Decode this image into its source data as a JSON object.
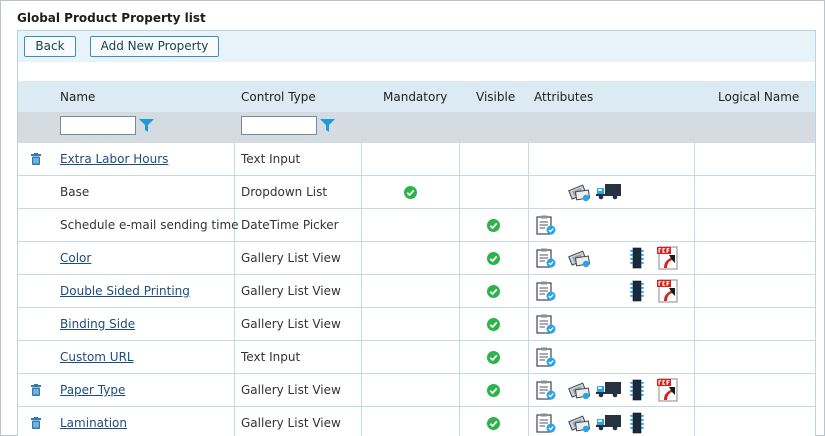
{
  "page_title": "Global Product Property list",
  "toolbar": {
    "back_label": "Back",
    "add_label": "Add New Property"
  },
  "columns": {
    "name": "Name",
    "control_type": "Control Type",
    "mandatory": "Mandatory",
    "visible": "Visible",
    "attributes": "Attributes",
    "logical_name": "Logical Name"
  },
  "filters": {
    "name_value": "",
    "control_type_value": ""
  },
  "colors": {
    "accent": "#1e9bd7",
    "header_bg": "#dbeaf3",
    "filter_bg": "#d4dce2",
    "check_green": "#2db34a",
    "link": "#1d4d7a"
  },
  "rows": [
    {
      "name": "Extra Labor Hours",
      "is_link": true,
      "deletable": true,
      "control_type": "Text Input",
      "mandatory": false,
      "visible": false,
      "attributes": []
    },
    {
      "name": "Base",
      "is_link": false,
      "deletable": false,
      "control_type": "Dropdown List",
      "mandatory": true,
      "visible": false,
      "attributes": [
        "price-tag-icon",
        "delivery-truck-icon"
      ]
    },
    {
      "name": "Schedule e-mail sending time",
      "is_link": false,
      "deletable": false,
      "control_type": "DateTime Picker",
      "mandatory": false,
      "visible": true,
      "attributes": [
        "checklist-icon"
      ]
    },
    {
      "name": "Color",
      "is_link": true,
      "deletable": false,
      "control_type": "Gallery List View",
      "mandatory": false,
      "visible": true,
      "attributes": [
        "checklist-icon",
        "price-tag-icon",
        "chip-icon",
        "pdf-icon"
      ]
    },
    {
      "name": "Double Sided Printing",
      "is_link": true,
      "deletable": false,
      "control_type": "Gallery List View",
      "mandatory": false,
      "visible": true,
      "attributes": [
        "checklist-icon",
        "chip-icon",
        "pdf-icon"
      ]
    },
    {
      "name": "Binding Side",
      "is_link": true,
      "deletable": false,
      "control_type": "Gallery List View",
      "mandatory": false,
      "visible": true,
      "attributes": [
        "checklist-icon"
      ]
    },
    {
      "name": "Custom URL",
      "is_link": true,
      "deletable": false,
      "control_type": "Text Input",
      "mandatory": false,
      "visible": true,
      "attributes": [
        "checklist-icon"
      ]
    },
    {
      "name": "Paper Type",
      "is_link": true,
      "deletable": true,
      "control_type": "Gallery List View",
      "mandatory": false,
      "visible": true,
      "attributes": [
        "checklist-icon",
        "price-tag-icon",
        "delivery-truck-icon",
        "chip-icon",
        "pdf-icon"
      ]
    },
    {
      "name": "Lamination",
      "is_link": true,
      "deletable": true,
      "control_type": "Gallery List View",
      "mandatory": false,
      "visible": true,
      "attributes": [
        "checklist-icon",
        "price-tag-icon",
        "delivery-truck-icon",
        "chip-icon"
      ]
    }
  ]
}
